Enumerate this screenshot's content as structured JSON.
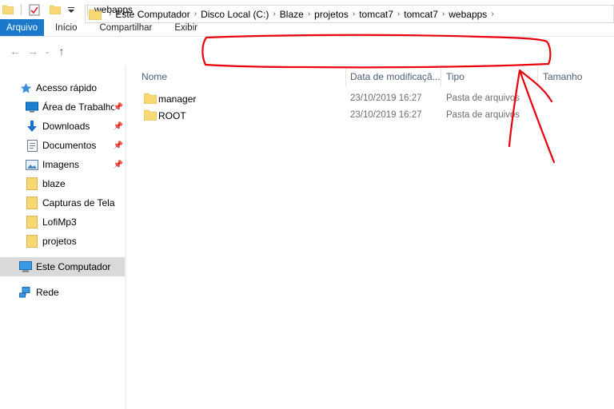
{
  "window": {
    "title": "webapps"
  },
  "ribbon": {
    "tabs": [
      "Arquivo",
      "Início",
      "Compartilhar",
      "Exibir"
    ]
  },
  "address": {
    "crumbs": [
      "Este Computador",
      "Disco Local (C:)",
      "Blaze",
      "projetos",
      "tomcat7",
      "tomcat7",
      "webapps"
    ]
  },
  "sidebar": {
    "quick_access": "Acesso rápido",
    "items": [
      {
        "label": "Área de Trabalho",
        "icon": "desktop-icon",
        "pinned": true
      },
      {
        "label": "Downloads",
        "icon": "download-icon",
        "pinned": true
      },
      {
        "label": "Documentos",
        "icon": "documents-icon",
        "pinned": true
      },
      {
        "label": "Imagens",
        "icon": "images-icon",
        "pinned": true
      },
      {
        "label": "blaze",
        "icon": "folder-icon",
        "pinned": false
      },
      {
        "label": "Capturas de Tela",
        "icon": "folder-icon",
        "pinned": false
      },
      {
        "label": "LofiMp3",
        "icon": "folder-icon",
        "pinned": false
      },
      {
        "label": "projetos",
        "icon": "folder-icon",
        "pinned": false
      }
    ],
    "this_pc": "Este Computador",
    "network": "Rede"
  },
  "columns": {
    "name": "Nome",
    "date": "Data de modificaçã...",
    "type": "Tipo",
    "size": "Tamanho"
  },
  "files": [
    {
      "name": "manager",
      "date": "23/10/2019 16:27",
      "type": "Pasta de arquivos"
    },
    {
      "name": "ROOT",
      "date": "23/10/2019 16:27",
      "type": "Pasta de arquivos"
    }
  ],
  "colors": {
    "accent": "#1979ca",
    "folder": "#f8d775",
    "annotation": "#e8000b",
    "selected": "#d9d9d9"
  }
}
